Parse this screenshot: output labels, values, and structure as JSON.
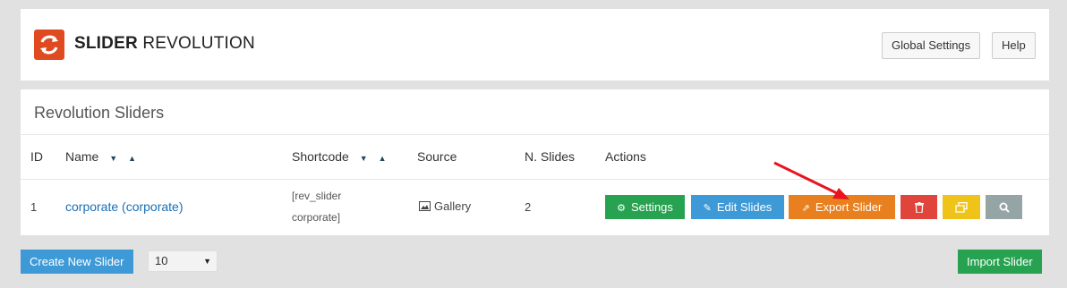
{
  "header": {
    "logo_bold": "SLIDER",
    "logo_light": "REVOLUTION",
    "global_settings_label": "Global Settings",
    "help_label": "Help"
  },
  "panel": {
    "title": "Revolution Sliders",
    "columns": {
      "id": "ID",
      "name": "Name",
      "shortcode": "Shortcode",
      "source": "Source",
      "nslides": "N. Slides",
      "actions": "Actions"
    },
    "rows": [
      {
        "id": "1",
        "name": "corporate (corporate)",
        "shortcode_line1": "[rev_slider",
        "shortcode_line2": "corporate]",
        "source": "Gallery",
        "nslides": "2"
      }
    ],
    "actions": {
      "settings_label": "Settings",
      "edit_label": "Edit Slides",
      "export_label": "Export Slider"
    }
  },
  "footer": {
    "create_label": "Create New Slider",
    "per_page": "10",
    "import_label": "Import Slider"
  },
  "colors": {
    "brand": "#e04a21",
    "green": "#27a251",
    "blue": "#3e9ad6",
    "orange": "#e8801f",
    "red": "#e0443b",
    "yellow": "#f0c31a",
    "gray": "#95a5a6",
    "arrow": "#e8141e"
  },
  "icons": [
    "refresh-icon",
    "sort-desc-icon",
    "sort-asc-icon",
    "image-icon",
    "gear-icon",
    "pencil-icon",
    "share-icon",
    "trash-icon",
    "duplicate-icon",
    "search-icon",
    "caret-down-icon",
    "annotation-arrow"
  ]
}
